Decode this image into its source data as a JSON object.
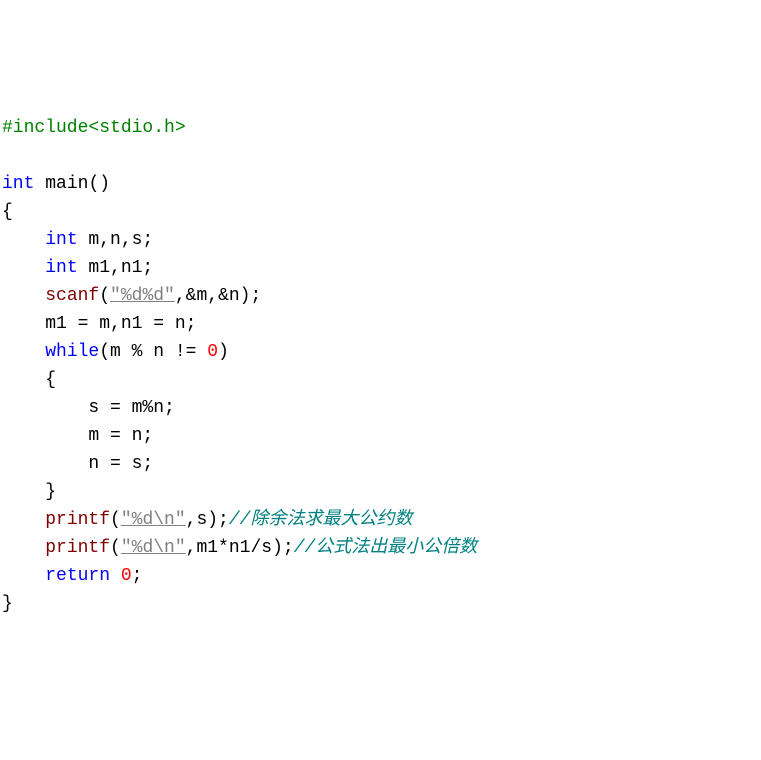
{
  "code": {
    "include_hash": "#include",
    "include_header": "<stdio.h>",
    "kw_int": "int",
    "main_name": "main",
    "open_paren": "()",
    "brace_open": "{",
    "brace_close": "}",
    "decl1_vars": " m,n,s;",
    "decl2_vars": " m1,n1;",
    "scanf_name": "scanf",
    "scanf_open": "(",
    "fmt1": "\"%d%d\"",
    "scanf_args": ",&m,&n);",
    "assign_line": "m1 = m,n1 = n;",
    "kw_while": "while",
    "while_cond": "(m % n != ",
    "zero": "0",
    "while_close": ")",
    "inner_brace_open": "{",
    "stmt_s": "s = m%n;",
    "stmt_m": "m = n;",
    "stmt_n": "n = s;",
    "inner_brace_close": "}",
    "printf_name": "printf",
    "printf_open": "(",
    "fmt2": "\"%d\\n\"",
    "printf1_args": ",s);",
    "comment1": "//除余法求最大公约数",
    "printf2_args": ",m1*n1/s);",
    "comment2": "//公式法出最小公倍数",
    "kw_return": "return",
    "return_sp": " ",
    "semicolon": ";"
  }
}
